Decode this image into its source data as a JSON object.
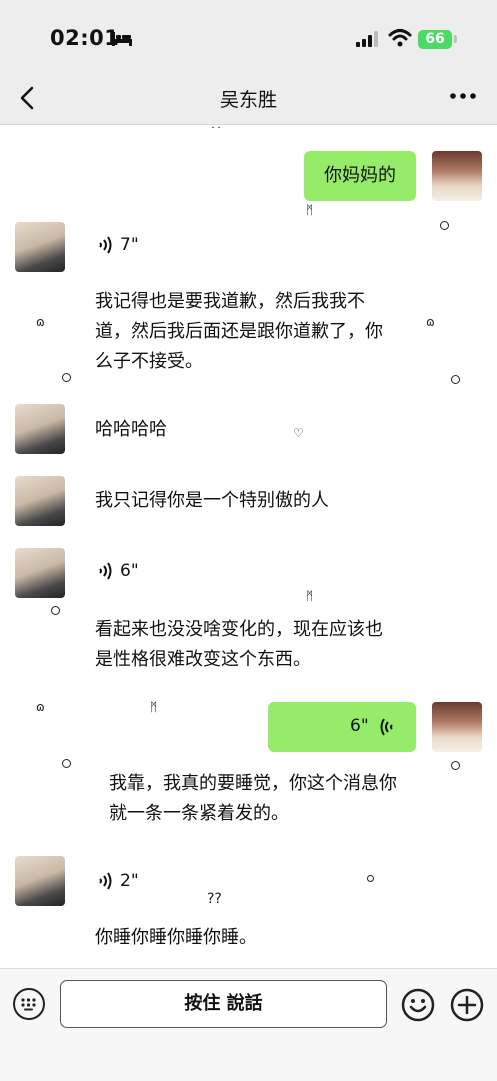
{
  "status_bar": {
    "time": "02:01",
    "battery": "66"
  },
  "navbar": {
    "title": "吴东胜"
  },
  "messages": {
    "m1_text": "你妈妈的",
    "m2_duration": "7\"",
    "m3_text": "我记得也是要我道歉，然后我我不道，然后我后面还是跟你道歉了，你么子不接受。",
    "m4_text": "哈哈哈哈",
    "m5_text": "我只记得你是一个特别傲的人",
    "m6_duration": "6\"",
    "m7_text": "看起来也没没啥变化的，现在应该也是性格很难改变这个东西。",
    "m8_duration": "6\"",
    "m9_text": "我靠，我真的要睡觉，你这个消息你就一条一条紧着发的。",
    "m10_duration": "2\"",
    "m11_text": "你睡你睡你睡你睡。"
  },
  "decorations": {
    "q1": "??",
    "q2": "??"
  },
  "input_bar": {
    "talk_label": "按住 說話"
  },
  "colors": {
    "bubble_me": "#95ec69",
    "battery": "#4cd964",
    "background": "#ededed",
    "chat_background": "#ffffff"
  },
  "icons": [
    "bed-icon",
    "signal-icon",
    "wifi-icon",
    "battery-icon",
    "back-icon",
    "more-icon",
    "voice-icon",
    "keyboard-icon",
    "emoji-icon",
    "plus-icon"
  ]
}
